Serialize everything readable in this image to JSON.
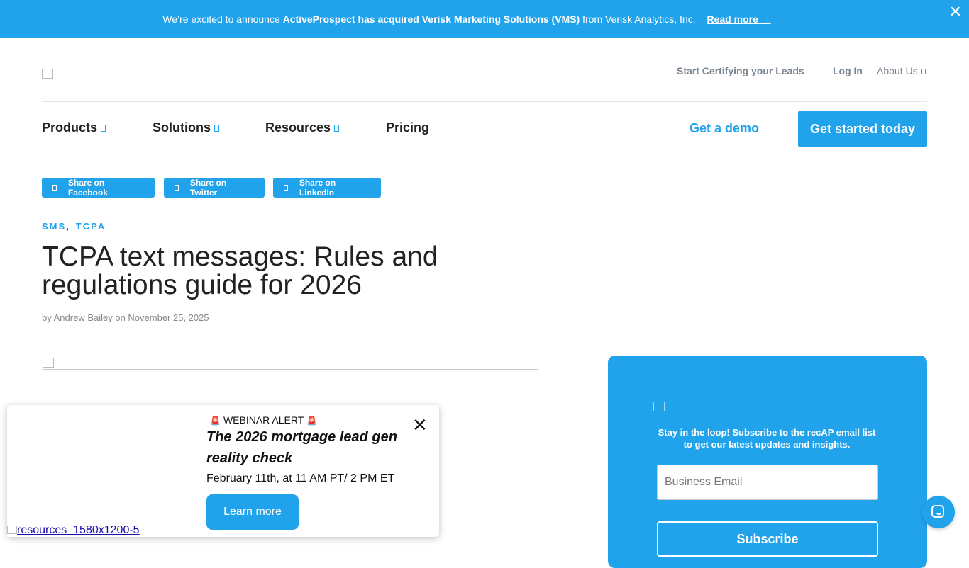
{
  "banner": {
    "prefix": "We’re excited to announce ",
    "highlight": "ActiveProspect has acquired Verisk Marketing Solutions (VMS)",
    "suffix": " from Verisk Analytics, Inc.",
    "read_more": "Read more →",
    "close": "✕"
  },
  "header": {
    "top_links": [
      "Start Certifying your Leads",
      "Log In",
      "About Us"
    ],
    "nav": [
      "Products",
      "Solutions",
      "Resources",
      "Pricing"
    ],
    "demo": "Get a demo",
    "cta": "Get started today"
  },
  "share": [
    "Share on Facebook",
    "Share on Twitter",
    "Share on LinkedIn"
  ],
  "article": {
    "tags": [
      "SMS",
      "TCPA"
    ],
    "tag_separator": ",",
    "title": "TCPA text messages: Rules and regulations guide for 2026",
    "by": "by ",
    "author": "Andrew Bailey",
    "on": " on ",
    "date": "November 25, 2025"
  },
  "subscribe": {
    "message": "Stay in the loop! Subscribe to the recAP email list to get our latest updates and insights.",
    "email_placeholder": "Business Email",
    "button": "Subscribe"
  },
  "popup": {
    "bell": "🚨",
    "alert": "WEBINAR ALERT",
    "title": "The 2026 mortgage lead gen reality check",
    "date": "February 11th, at 11 AM PT/ 2 PM ET",
    "button": "Learn more",
    "close": "✕",
    "image_alt": "resources_1580x1200-5"
  },
  "colors": {
    "accent": "#21a3ec",
    "text": "#222222",
    "muted": "#7a8590"
  }
}
